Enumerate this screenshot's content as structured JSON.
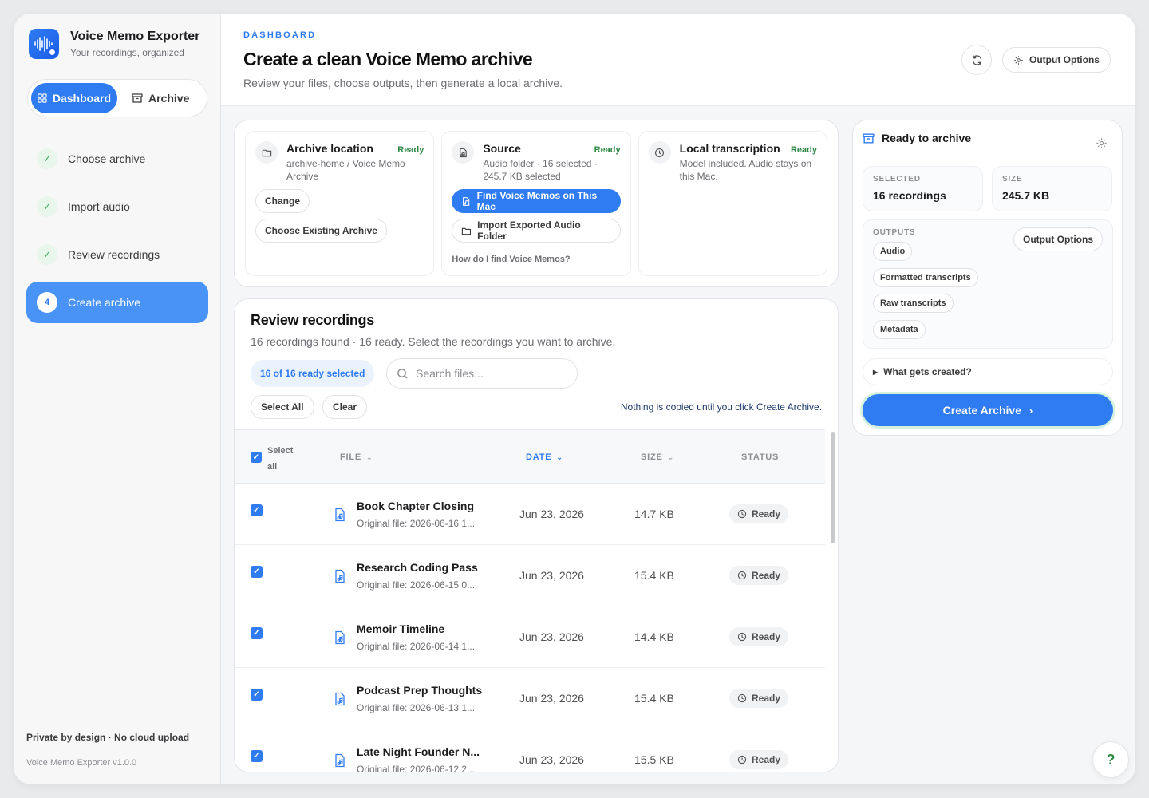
{
  "app": {
    "name": "Voice Memo Exporter",
    "tagline": "Your recordings, organized",
    "version": "Voice Memo Exporter v1.0.0",
    "privacy": "Private by design · No cloud upload"
  },
  "nav": {
    "dashboard": "Dashboard",
    "archive": "Archive"
  },
  "steps": [
    {
      "label": "Choose archive",
      "state": "done"
    },
    {
      "label": "Import audio",
      "state": "done"
    },
    {
      "label": "Review recordings",
      "state": "done"
    },
    {
      "label": "Create archive",
      "state": "current",
      "num": "4"
    }
  ],
  "header": {
    "eyebrow": "DASHBOARD",
    "title": "Create a clean Voice Memo archive",
    "subtitle": "Review your files, choose outputs, then generate a local archive.",
    "output_options": "Output Options"
  },
  "cards": {
    "archive": {
      "name": "Archive location",
      "status": "Ready",
      "desc": "archive-home / Voice Memo Archive",
      "change": "Change",
      "choose": "Choose Existing Archive"
    },
    "source": {
      "name": "Source",
      "status": "Ready",
      "desc": "Audio folder · 16 selected · 245.7 KB selected",
      "find": "Find Voice Memos on This Mac",
      "import": "Import Exported Audio Folder",
      "help": "How do I find Voice Memos?"
    },
    "transcription": {
      "name": "Local transcription",
      "status": "Ready",
      "desc": "Model included. Audio stays on this Mac."
    }
  },
  "review": {
    "title": "Review recordings",
    "subtitle": "16 recordings found · 16 ready. Select the recordings you want to archive.",
    "selected_badge": "16 of 16 ready selected",
    "search_placeholder": "Search files...",
    "select_all": "Select All",
    "clear": "Clear",
    "note": "Nothing is copied until you click Create Archive.",
    "columns": {
      "select_all_line1": "Select",
      "select_all_line2": "all",
      "file": "FILE",
      "date": "DATE",
      "size": "SIZE",
      "status": "STATUS"
    },
    "rows": [
      {
        "name": "Book Chapter Closing",
        "original": "Original file: 2026-06-16 1...",
        "date": "Jun 23, 2026",
        "size": "14.7 KB",
        "status": "Ready"
      },
      {
        "name": "Research Coding Pass",
        "original": "Original file: 2026-06-15 0...",
        "date": "Jun 23, 2026",
        "size": "15.4 KB",
        "status": "Ready"
      },
      {
        "name": "Memoir Timeline",
        "original": "Original file: 2026-06-14 1...",
        "date": "Jun 23, 2026",
        "size": "14.4 KB",
        "status": "Ready"
      },
      {
        "name": "Podcast Prep Thoughts",
        "original": "Original file: 2026-06-13 1...",
        "date": "Jun 23, 2026",
        "size": "15.4 KB",
        "status": "Ready"
      },
      {
        "name": "Late Night Founder N...",
        "original": "Original file: 2026-06-12 2...",
        "date": "Jun 23, 2026",
        "size": "15.5 KB",
        "status": "Ready"
      }
    ]
  },
  "summary": {
    "title": "Ready to archive",
    "selected_label": "SELECTED",
    "selected_value": "16 recordings",
    "size_label": "SIZE",
    "size_value": "245.7 KB",
    "outputs_label": "OUTPUTS",
    "outputs_button": "Output Options",
    "outputs": [
      "Audio",
      "Formatted transcripts",
      "Raw transcripts",
      "Metadata"
    ],
    "details": "What gets created?",
    "create": "Create Archive"
  },
  "help_fab": "?",
  "colors": {
    "accent": "#2f7bf2",
    "ready": "#2f8a46"
  }
}
